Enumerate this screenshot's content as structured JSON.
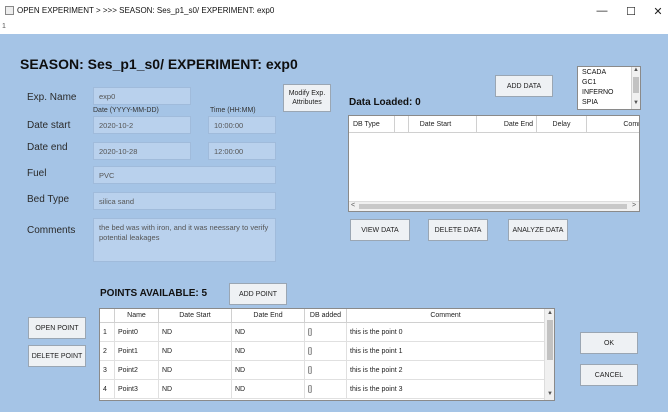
{
  "window": {
    "title": "OPEN EXPERIMENT > >>> SEASON: Ses_p1_s0/ EXPERIMENT: exp0",
    "subtitle": "1",
    "minimize_glyph": "—",
    "maximize_glyph": "☐",
    "close_glyph": "✕"
  },
  "header": {
    "title": "SEASON: Ses_p1_s0/ EXPERIMENT: exp0"
  },
  "form": {
    "exp_name_label": "Exp. Name",
    "exp_name_value": "exp0",
    "date_format_label": "Date (YYYY-MM-DD)",
    "time_format_label": "Time (HH:MM)",
    "date_start_label": "Date start",
    "date_start_value": "2020-10-2",
    "time_start_value": "10:00:00",
    "date_end_label": "Date end",
    "date_end_value": "2020-10-28",
    "time_end_value": "12:00:00",
    "fuel_label": "Fuel",
    "fuel_value": "PVC",
    "bed_type_label": "Bed Type",
    "bed_type_value": "silica sand",
    "comments_label": "Comments",
    "comments_value": "the bed was with iron, and it was neessary to verify potential leakages",
    "modify_button": "Modify Exp. Attributes"
  },
  "data_panel": {
    "add_data_button": "ADD DATA",
    "source_list": [
      "SCADA",
      "GC1",
      "INFERNO",
      "SPIA"
    ],
    "loaded_label": "Data Loaded: 0",
    "columns": [
      "DB Type",
      "Date Start",
      "Date End",
      "Delay",
      "Comm"
    ],
    "view_button": "VIEW DATA",
    "delete_button": "DELETE DATA",
    "analyze_button": "ANALYZE DATA"
  },
  "points": {
    "title": "POINTS AVAILABLE: 5",
    "add_button": "ADD POINT",
    "open_button": "OPEN POINT",
    "delete_button": "DELETE POINT",
    "columns": [
      "Name",
      "Date Start",
      "Date End",
      "DB added",
      "Comment"
    ],
    "rows": [
      {
        "index": "1",
        "name": "Point0",
        "start": "ND",
        "end": "ND",
        "db": "[]",
        "comment": "this is the point 0"
      },
      {
        "index": "2",
        "name": "Point1",
        "start": "ND",
        "end": "ND",
        "db": "[]",
        "comment": "this is the point 1"
      },
      {
        "index": "3",
        "name": "Point2",
        "start": "ND",
        "end": "ND",
        "db": "[]",
        "comment": "this is the point 2"
      },
      {
        "index": "4",
        "name": "Point3",
        "start": "ND",
        "end": "ND",
        "db": "[]",
        "comment": "this is the point 3"
      }
    ]
  },
  "dialog": {
    "ok_button": "OK",
    "cancel_button": "CANCEL"
  },
  "colors": {
    "panel_background": "#a5c4e6",
    "field_background": "#b9d1ed",
    "button_background": "#eef1f4"
  },
  "icons": {
    "app": "app-icon",
    "minimize": "minimize-icon",
    "maximize": "maximize-icon",
    "close": "close-icon",
    "scroll_up": "chevron-up-icon",
    "scroll_down": "chevron-down-icon",
    "scroll_left": "chevron-left-icon",
    "scroll_right": "chevron-right-icon"
  }
}
